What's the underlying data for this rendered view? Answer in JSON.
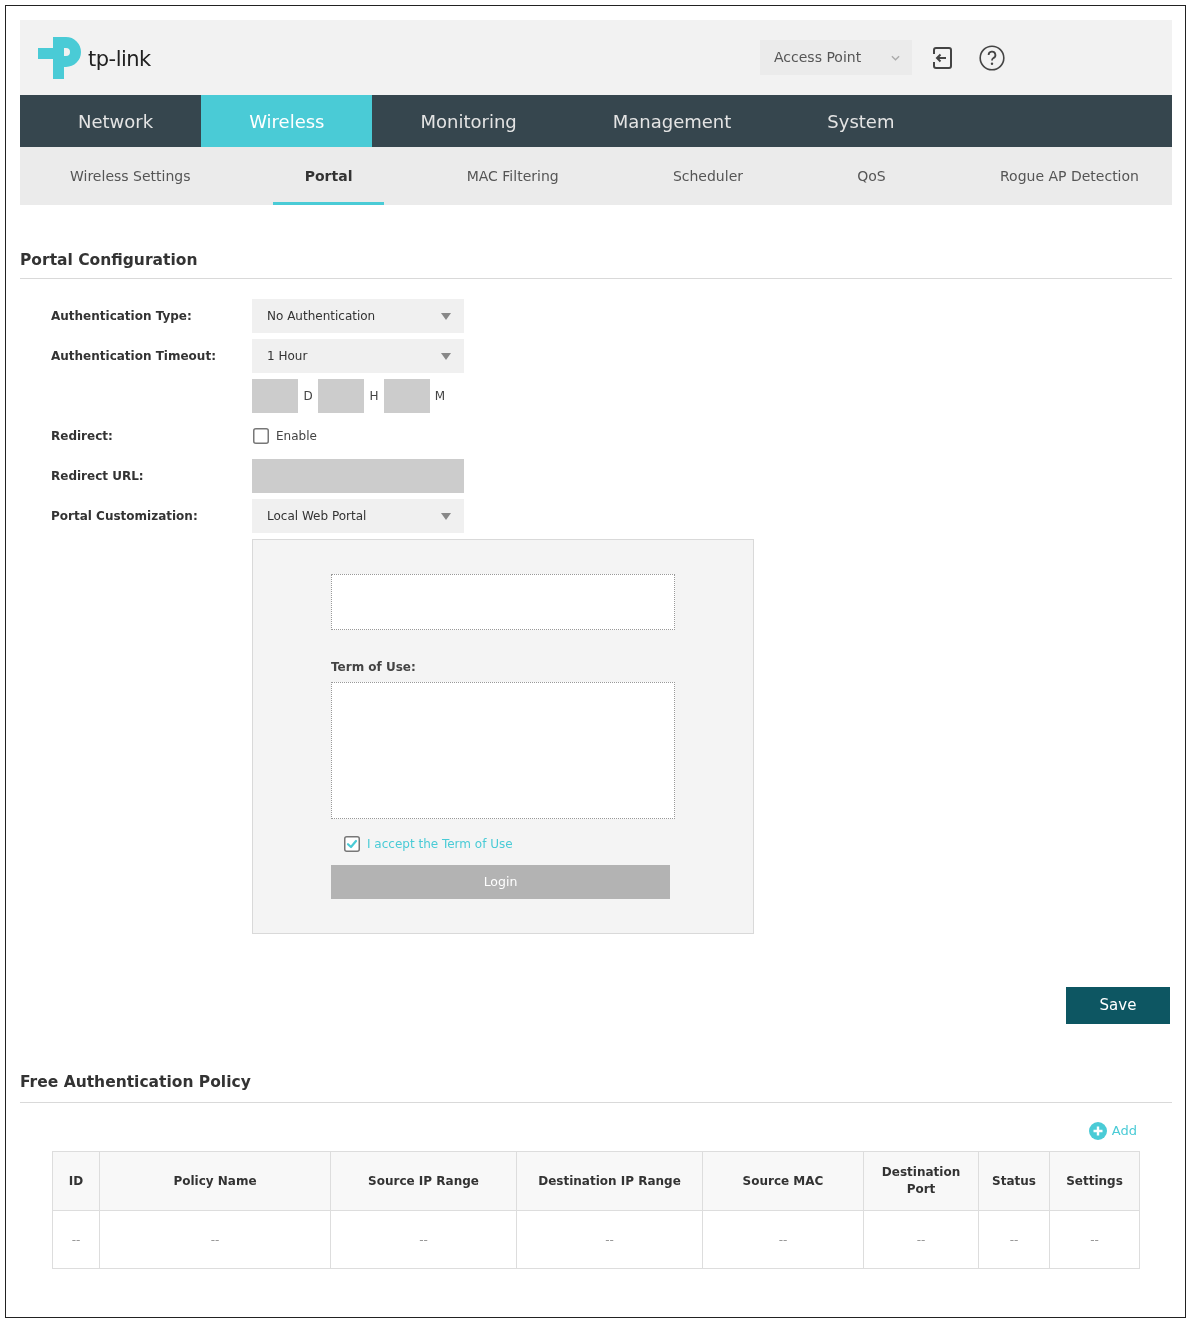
{
  "header": {
    "logo_text": "tp-link",
    "mode": "Access Point"
  },
  "main_nav": [
    {
      "label": "Network",
      "selected": false
    },
    {
      "label": "Wireless",
      "selected": true
    },
    {
      "label": "Monitoring",
      "selected": false
    },
    {
      "label": "Management",
      "selected": false
    },
    {
      "label": "System",
      "selected": false
    }
  ],
  "sub_nav": [
    {
      "label": "Wireless Settings",
      "selected": false
    },
    {
      "label": "Portal",
      "selected": true
    },
    {
      "label": "MAC Filtering",
      "selected": false
    },
    {
      "label": "Scheduler",
      "selected": false
    },
    {
      "label": "QoS",
      "selected": false
    },
    {
      "label": "Rogue AP Detection",
      "selected": false
    }
  ],
  "portal_configuration": {
    "title": "Portal Configuration",
    "fields": [
      {
        "kind": "select",
        "label": "Authentication Type:",
        "value": "No Authentication"
      },
      {
        "kind": "select",
        "label": "Authentication Timeout:",
        "value": "1 Hour"
      },
      {
        "kind": "duration",
        "disabled": true,
        "units": [
          "D",
          "H",
          "M"
        ]
      },
      {
        "kind": "checkbox",
        "label": "Redirect:",
        "option": "Enable",
        "checked": false
      },
      {
        "kind": "text",
        "label": "Redirect URL:",
        "disabled": true
      },
      {
        "kind": "select",
        "label": "Portal Customization:",
        "value": "Local Web Portal"
      }
    ],
    "preview": {
      "terms_label": "Term of Use:",
      "accept_label": "I accept the Term of Use",
      "accept_checked": true,
      "login_button": "Login"
    },
    "save_button": "Save"
  },
  "free_authentication_policy": {
    "title": "Free Authentication Policy",
    "add_button": "Add",
    "table": {
      "columns": [
        "ID",
        "Policy Name",
        "Source IP Range",
        "Destination IP Range",
        "Source MAC",
        "Destination Port",
        "Status",
        "Settings"
      ],
      "rows": [
        [
          "--",
          "--",
          "--",
          "--",
          "--",
          "--",
          "--",
          "--"
        ]
      ]
    }
  }
}
